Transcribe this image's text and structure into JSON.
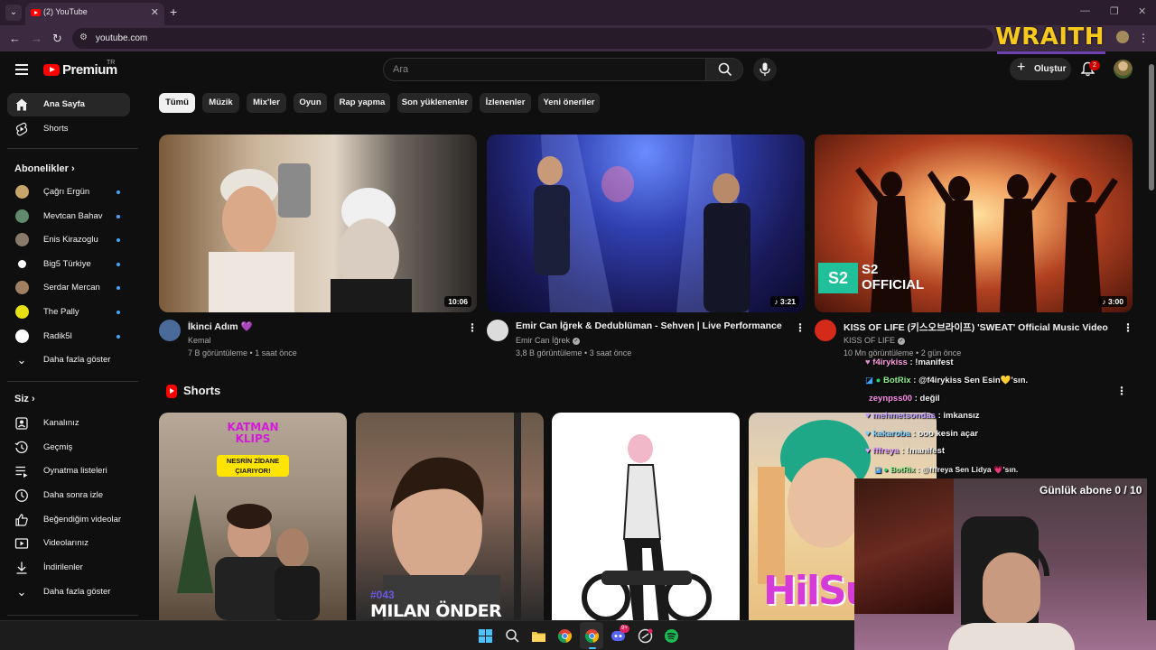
{
  "browser": {
    "tab_title": "(2) YouTube",
    "url": "youtube.com"
  },
  "overlay": {
    "brand": "WRAITH",
    "subs_counter": "Günlük abone 0 / 10"
  },
  "header": {
    "logo_text": "Premium",
    "logo_region": "TR",
    "search_placeholder": "Ara",
    "create_label": "Oluştur",
    "notification_count": "2"
  },
  "sidebar": {
    "main": [
      {
        "label": "Ana Sayfa",
        "icon": "home-icon",
        "active": true
      },
      {
        "label": "Shorts",
        "icon": "shorts-icon",
        "active": false
      }
    ],
    "subscriptions_heading": "Abonelikler",
    "subscriptions": [
      {
        "label": "Çağrı Ergün",
        "color": "#c7a46a"
      },
      {
        "label": "Mevtcan Bahav",
        "color": "#5f8a6e"
      },
      {
        "label": "Enis Kirazoglu",
        "color": "#8a7a6a"
      },
      {
        "label": "Big5 Türkiye",
        "color": "#ffffff"
      },
      {
        "label": "Serdar Mercan",
        "color": "#a08060"
      },
      {
        "label": "The Pally",
        "color": "#e8e010"
      },
      {
        "label": "Radik5l",
        "color": "#ffffff"
      }
    ],
    "show_more": "Daha fazla göster",
    "you_heading": "Siz",
    "you_items": [
      {
        "label": "Kanalınız",
        "icon": "channel-icon"
      },
      {
        "label": "Geçmiş",
        "icon": "history-icon"
      },
      {
        "label": "Oynatma listeleri",
        "icon": "playlist-icon"
      },
      {
        "label": "Daha sonra izle",
        "icon": "clock-icon"
      },
      {
        "label": "Beğendiğim videolar",
        "icon": "thumbs-up-icon"
      },
      {
        "label": "Videolarınız",
        "icon": "video-icon"
      },
      {
        "label": "İndirilenler",
        "icon": "download-icon"
      },
      {
        "label": "Daha fazla göster",
        "icon": "chevron-down-icon"
      }
    ]
  },
  "chips": [
    "Tümü",
    "Müzik",
    "Mix'ler",
    "Oyun",
    "Rap yapma",
    "Son yüklenenler",
    "İzlenenler",
    "Yeni öneriler"
  ],
  "videos": [
    {
      "title": "İkinci Adım 💜",
      "channel": "Kemal",
      "meta": "7 B görüntüleme • 1 saat önce",
      "duration": "10:06",
      "verified": false
    },
    {
      "title": "Emir Can İğrek & Dedublüman - Sehven | Live Performance",
      "channel": "Emir Can İğrek",
      "meta": "3,8 B görüntüleme • 3 saat önce",
      "duration": "♪ 3:21",
      "verified": true
    },
    {
      "title": "KISS OF LIFE (키스오브라이프) 'SWEAT' Official Music Video",
      "channel": "KISS OF LIFE",
      "meta": "10 Mn görüntüleme • 2 gün önce",
      "duration": "♪ 3:00",
      "verified": true
    }
  ],
  "s2_badge": {
    "mark": "S2",
    "line1": "S2",
    "line2": "OFFICIAL"
  },
  "shorts": {
    "heading": "Shorts",
    "s1_klips": "KATMAN KLIPS",
    "s1_banner": "NESRİN ZİDANE ÇIARIYOR!",
    "s2_episode": "#043",
    "s2_name": "MILAN ÖNDER",
    "s4_text": "HilSu"
  },
  "chat": [
    {
      "user": "f4irykiss",
      "message": "!manifest",
      "color": "#ff9be0"
    },
    {
      "user": "BotRix",
      "message": "@f4irykiss Sen Esin💛'sın.",
      "color": "#8cf08c"
    },
    {
      "user": "zeynpss00",
      "message": "değil",
      "color": "#ff8cf0"
    },
    {
      "user": "mehmetsondas",
      "message": "imkansız",
      "color": "#b89cff"
    },
    {
      "user": "kakaroba",
      "message": "ooo kesin açar",
      "color": "#7ad0ff"
    },
    {
      "user": "fffreya",
      "message": "!manifest",
      "color": "#e0a0ff"
    },
    {
      "user": "BotRix",
      "message": "@fffreya Sen Lidya 💗'sın.",
      "color": "#8cf08c"
    }
  ],
  "taskbar_badges": {
    "discord": "9+"
  }
}
